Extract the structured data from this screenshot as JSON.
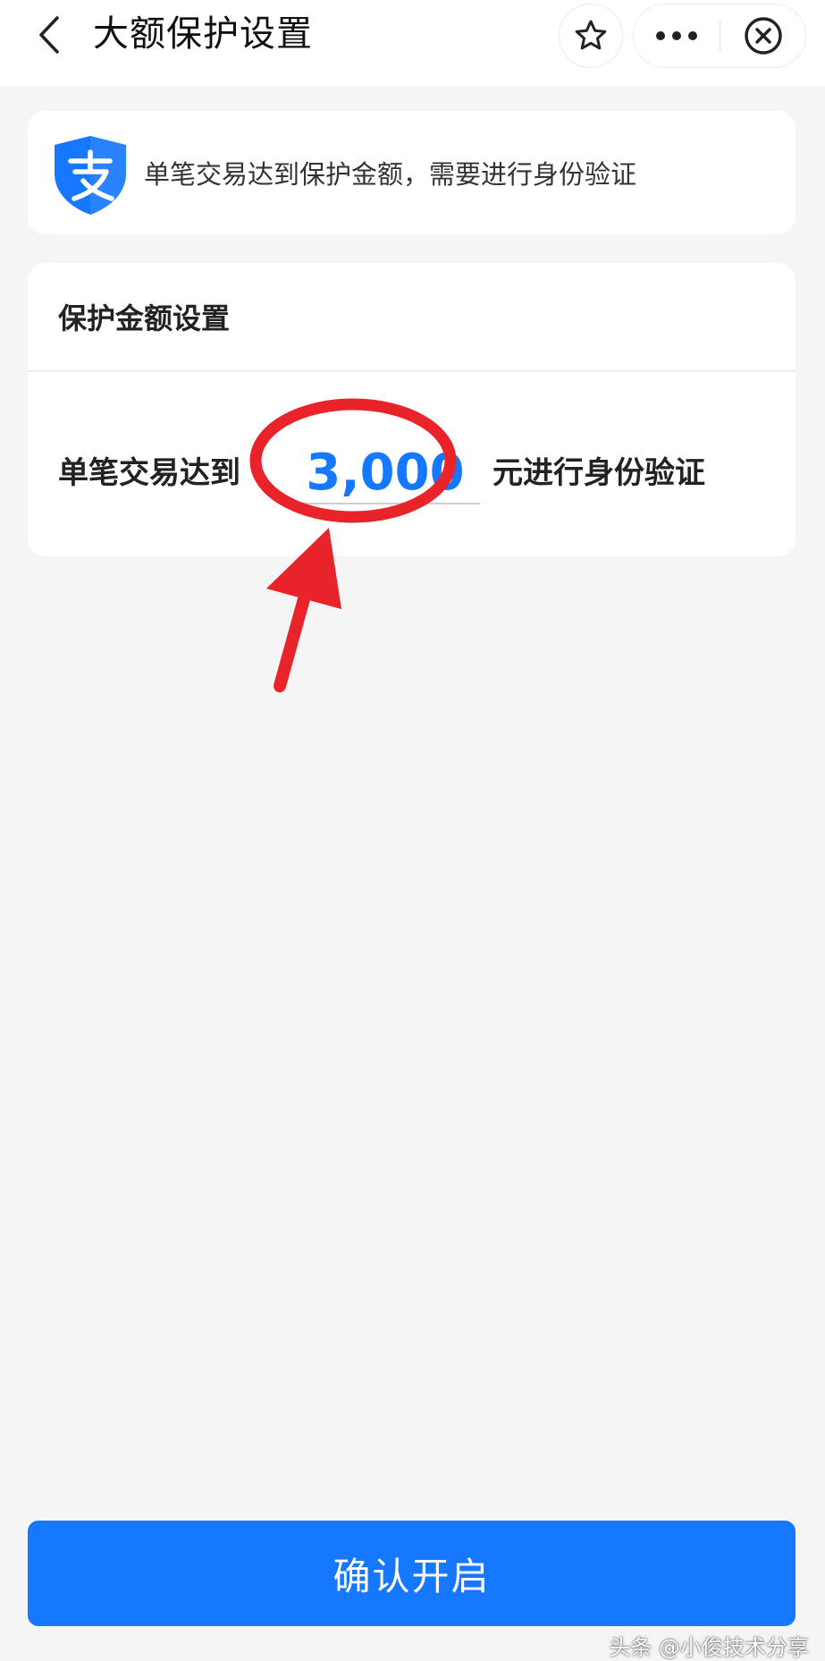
{
  "header": {
    "title": "大额保护设置",
    "icons": {
      "back": "chevron-left-icon",
      "favorite": "star-icon",
      "more": "more-dots-icon",
      "close": "close-circle-icon"
    }
  },
  "info_banner": {
    "logo": "alipay-shield-logo",
    "text": "单笔交易达到保护金额，需要进行身份验证"
  },
  "settings": {
    "title": "保护金额设置",
    "prefix": "单笔交易达到",
    "amount": "3,000",
    "suffix": "元进行身份验证"
  },
  "confirm": {
    "label": "确认开启"
  },
  "watermark": {
    "text": "头条 @小俊技术分享"
  },
  "colors": {
    "accent": "#1677ff",
    "annotation": "#e8232a",
    "background": "#f5f5f5"
  }
}
